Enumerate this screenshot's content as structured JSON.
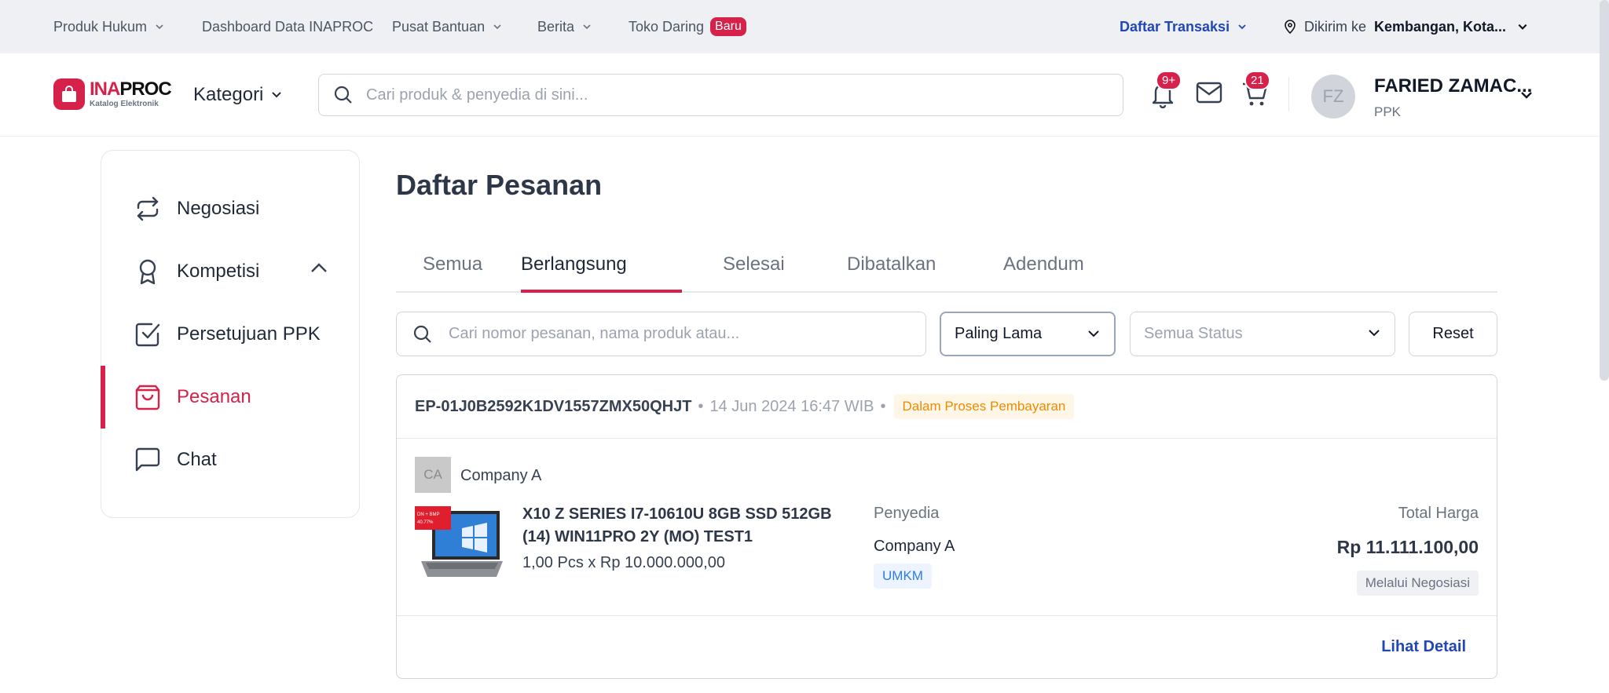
{
  "topbar": {
    "produk_hukum": "Produk Hukum",
    "dashboard": "Dashboard Data INAPROC",
    "pusat_bantuan": "Pusat Bantuan",
    "berita": "Berita",
    "toko_daring": "Toko Daring",
    "baru": "Baru",
    "daftar_transaksi": "Daftar Transaksi",
    "dikirim_label": "Dikirim ke",
    "dikirim_location": "Kembangan, Kota..."
  },
  "header": {
    "logo_text_1": "INA",
    "logo_text_2": "PROC",
    "logo_sub": "Katalog Elektronik",
    "kategori": "Kategori",
    "search_placeholder": "Cari produk & penyedia di sini...",
    "notif_count": "9+",
    "cart_count": "21",
    "avatar_initials": "FZ",
    "user_name": "FARIED ZAMAC...",
    "user_role": "PPK"
  },
  "sidebar": {
    "items": [
      {
        "label": "Negosiasi",
        "icon": "repeat-icon"
      },
      {
        "label": "Kompetisi",
        "icon": "award-icon"
      },
      {
        "label": "Persetujuan PPK",
        "icon": "check-square-icon"
      },
      {
        "label": "Pesanan",
        "icon": "shopping-bag-icon",
        "active": true
      },
      {
        "label": "Chat",
        "icon": "message-square-icon"
      }
    ]
  },
  "main": {
    "title": "Daftar Pesanan",
    "tabs": [
      "Semua",
      "Berlangsung",
      "Selesai",
      "Dibatalkan",
      "Adendum"
    ],
    "active_tab": "Berlangsung",
    "search_placeholder": "Cari nomor pesanan, nama produk atau...",
    "sort_value": "Paling Lama",
    "status_placeholder": "Semua Status",
    "reset_label": "Reset"
  },
  "order": {
    "number": "EP-01J0B2592K1DV1557ZMX50QHJT",
    "separator": "•",
    "date": "14 Jun 2024 16:47 WIB",
    "status": "Dalam Proses Pembayaran",
    "vendor_initials": "CA",
    "vendor_name": "Company A",
    "product_name": "X10 Z SERIES I7-10610U 8GB SSD 512GB (14) WIN11PRO 2Y (MO) TEST1",
    "quantity_price": "1,00 Pcs x Rp 10.000.000,00",
    "penyedia_label": "Penyedia",
    "penyedia_name": "Company A",
    "penyedia_tag": "UMKM",
    "total_label": "Total Harga",
    "total_price": "Rp 11.111.100,00",
    "via": "Melalui Negosiasi",
    "detail_link": "Lihat Detail"
  },
  "colors": {
    "brand_red": "#d6224a",
    "link_blue": "#2146b8",
    "status_orange": "#f08a00",
    "umkm_blue": "#2f7de1"
  }
}
